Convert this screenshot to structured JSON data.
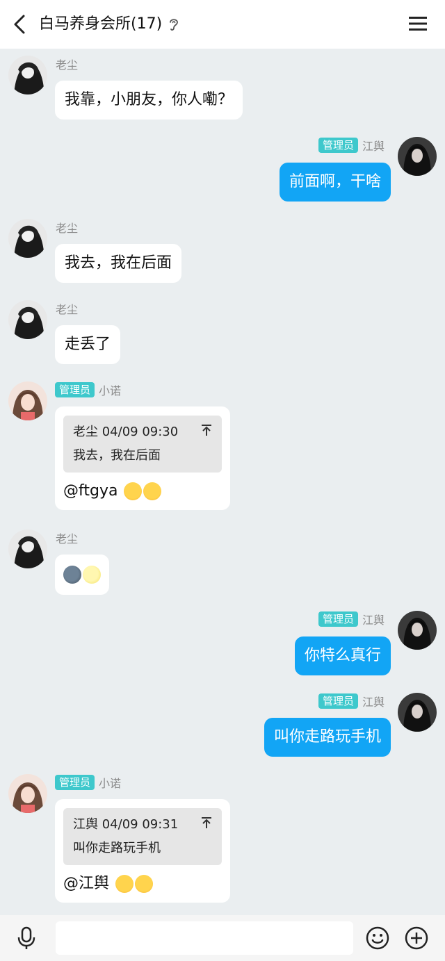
{
  "header": {
    "title": "白马养身会所(17)"
  },
  "messages": [
    {
      "side": "left",
      "name": "老尘",
      "text": "我靠，小朋友，你人嘞？"
    },
    {
      "side": "right",
      "badge": "管理员",
      "name": "江舆",
      "text": "前面啊，干啥"
    },
    {
      "side": "left",
      "name": "老尘",
      "text": "我去，我在后面"
    },
    {
      "side": "left",
      "name": "老尘",
      "text": "走丢了"
    },
    {
      "side": "left",
      "badge": "管理员",
      "name": "小诺",
      "quote_header": "老尘 04/09 09:30",
      "quote_text": "我去，我在后面",
      "text": "@ftgya"
    },
    {
      "side": "left",
      "name": "老尘",
      "text": ""
    },
    {
      "side": "right",
      "badge": "管理员",
      "name": "江舆",
      "text": "你特么真行"
    },
    {
      "side": "right",
      "badge": "管理员",
      "name": "江舆",
      "text": "叫你走路玩手机"
    },
    {
      "side": "left",
      "badge": "管理员",
      "name": "小诺",
      "quote_header": "江舆 04/09 09:31",
      "quote_text": "叫你走路玩手机",
      "text": "@江舆"
    }
  ],
  "icons": [
    "back-arrow-icon",
    "ear-icon",
    "menu-icon",
    "microphone-icon",
    "emoji-icon",
    "plus-icon",
    "quote-jump-icon",
    "laughing-emoji-icon",
    "dark-moon-emoji-icon",
    "light-moon-emoji-icon"
  ],
  "colors": {
    "accent": "#12a5f5",
    "badge": "#3ec8cc",
    "background": "#eaeef0"
  }
}
